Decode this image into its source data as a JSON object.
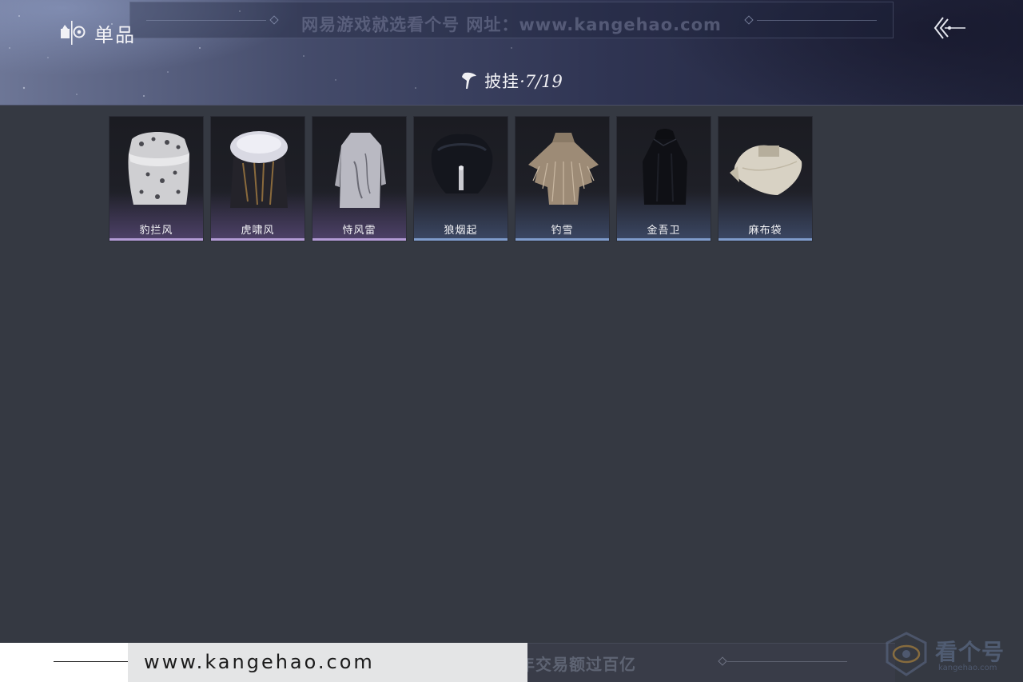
{
  "header": {
    "tab_label": "单品",
    "watermark": "网易游戏就选看个号  网址：www.kangehao.com",
    "category": {
      "name": "披挂",
      "separator": "·",
      "count": "7/19"
    }
  },
  "items": [
    {
      "name": "豹拦风",
      "rarity": "purple"
    },
    {
      "name": "虎啸风",
      "rarity": "purple"
    },
    {
      "name": "恃风雷",
      "rarity": "purple"
    },
    {
      "name": "狼烟起",
      "rarity": "blue"
    },
    {
      "name": "钓雪",
      "rarity": "blue"
    },
    {
      "name": "金吾卫",
      "rarity": "blue"
    },
    {
      "name": "麻布袋",
      "rarity": "blue"
    }
  ],
  "footer": {
    "url": "www.kangehao.com",
    "slogan": "看个号专业网易游戏八年  年交易额过百亿",
    "brand_name": "看个号",
    "brand_url": "kangehao.com"
  },
  "colors": {
    "purple_accent": "#b39bd6",
    "blue_accent": "#7f9ccc",
    "background": "#353942"
  },
  "icons": {
    "tab": "single-item-icon",
    "back": "back-arrow-icon",
    "category": "cloak-icon"
  }
}
